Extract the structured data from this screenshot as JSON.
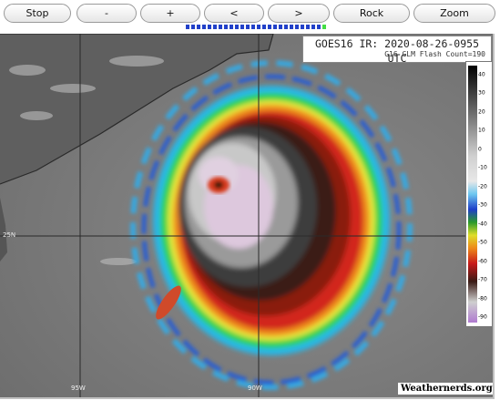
{
  "toolbar": {
    "buttons": [
      {
        "label": "Stop"
      },
      {
        "label": "-"
      },
      {
        "label": "+"
      },
      {
        "label": "<"
      },
      {
        "label": ">"
      },
      {
        "label": "Rock"
      },
      {
        "label": "Zoom"
      }
    ],
    "frame_count": 26,
    "current_frame": 26
  },
  "image": {
    "title": "GOES16 IR: 2020-08-26-0955 UTC",
    "subtitle": "G16 GLM Flash Count=190",
    "credit": "Weathernerds.org"
  },
  "gridlabels": {
    "lat_25": "25N",
    "lon_95": "95W",
    "lon_90": "90W"
  },
  "scale": {
    "ticks": [
      "40",
      "30",
      "20",
      "10",
      "0",
      "-10",
      "-20",
      "-30",
      "-40",
      "-50",
      "-60",
      "-70",
      "-80",
      "-90"
    ]
  },
  "colors": {
    "progress_fill": "#2241c9",
    "progress_current": "#44dd44"
  }
}
